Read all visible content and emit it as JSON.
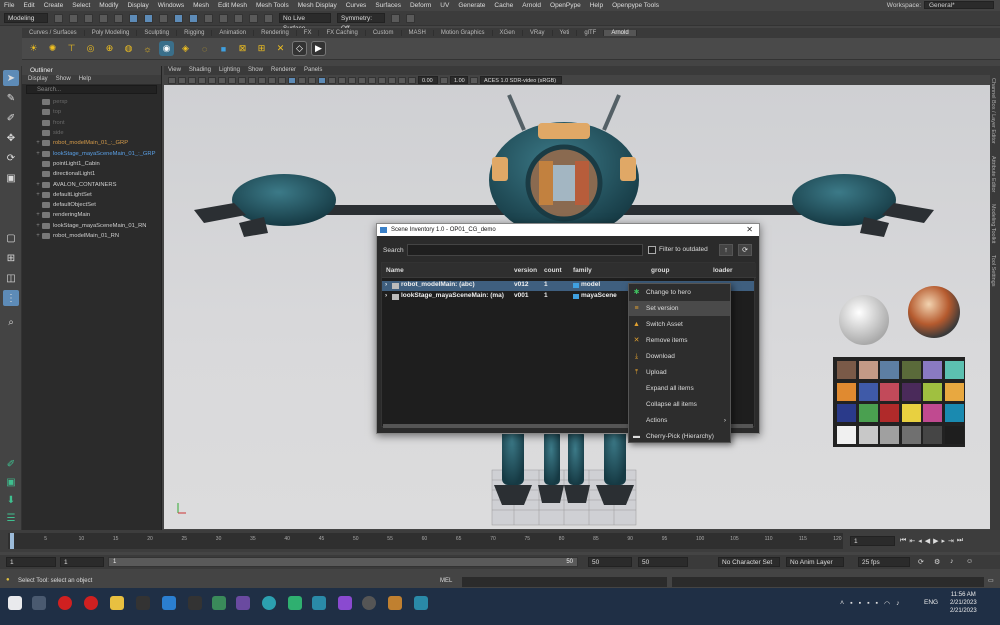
{
  "menubar": {
    "items": [
      "File",
      "Edit",
      "Create",
      "Select",
      "Modify",
      "Display",
      "Windows",
      "Mesh",
      "Edit Mesh",
      "Mesh Tools",
      "Mesh Display",
      "Curves",
      "Surfaces",
      "Deform",
      "UV",
      "Generate",
      "Cache",
      "Arnold",
      "OpenPype",
      "Help",
      "Openpype Tools"
    ],
    "workspace_label": "Workspace:",
    "workspace_value": "General*"
  },
  "statusline": {
    "mode": "Modeling",
    "live_surface": "No Live Surface",
    "symmetry": "Symmetry: Off"
  },
  "shelf_tabs": [
    "Curves / Surfaces",
    "Poly Modeling",
    "Sculpting",
    "Rigging",
    "Animation",
    "Rendering",
    "FX",
    "FX Caching",
    "Custom",
    "MASH",
    "Motion Graphics",
    "XGen",
    "VRay",
    "Yeti",
    "glTF",
    "Arnold"
  ],
  "outliner": {
    "title": "Outliner",
    "menu": [
      "Display",
      "Show",
      "Help"
    ],
    "search_placeholder": "Search...",
    "items": [
      {
        "label": "persp",
        "color": "#6a6a6a"
      },
      {
        "label": "top",
        "color": "#6a6a6a"
      },
      {
        "label": "front",
        "color": "#6a6a6a"
      },
      {
        "label": "side",
        "color": "#6a6a6a"
      },
      {
        "label": "robot_modelMain_01_:_GRP",
        "color": "#d59b4a"
      },
      {
        "label": "lookStage_mayaSceneMain_01_:_GRP",
        "color": "#5aa0e6"
      },
      {
        "label": "pointLight1_Cabin",
        "color": "#cfcfcf"
      },
      {
        "label": "directionalLight1",
        "color": "#cfcfcf"
      },
      {
        "label": "AVALON_CONTAINERS",
        "color": "#cfcfcf"
      },
      {
        "label": "defaultLightSet",
        "color": "#cfcfcf"
      },
      {
        "label": "defaultObjectSet",
        "color": "#cfcfcf"
      },
      {
        "label": "renderingMain",
        "color": "#cfcfcf"
      },
      {
        "label": "lookStage_mayaSceneMain_01_RN",
        "color": "#cfcfcf"
      },
      {
        "label": "robot_modelMain_01_RN",
        "color": "#cfcfcf"
      }
    ]
  },
  "panel_menu": [
    "View",
    "Shading",
    "Lighting",
    "Show",
    "Renderer",
    "Panels"
  ],
  "panel_tools": {
    "exposure": "0.00",
    "gamma": "1.00",
    "colorspace": "ACES 1.0 SDR-video (sRGB)"
  },
  "right_strip": [
    "Channel Box / Layer Editor",
    "Attribute Editor",
    "Modeling Toolkit",
    "Tool Settings"
  ],
  "dialog": {
    "title": "Scene Inventory 1.0 - OP01_CG_demo",
    "search_label": "Search",
    "filter_label": "Filter to outdated",
    "columns": [
      "Name",
      "version",
      "count",
      "family",
      "group",
      "loader"
    ],
    "rows": [
      {
        "name": "robot_modelMain: (abc)",
        "version": "v012",
        "count": "1",
        "family": "model"
      },
      {
        "name": "lookStage_mayaSceneMain: (ma)",
        "version": "v001",
        "count": "1",
        "family": "mayaScene"
      }
    ]
  },
  "context_menu": [
    {
      "label": "Change to hero",
      "icon": "✱",
      "color": "#3fbf5f"
    },
    {
      "label": "Set version",
      "icon": "≡",
      "color": "#e0a030"
    },
    {
      "label": "Switch Asset",
      "icon": "▲",
      "color": "#e0a030"
    },
    {
      "label": "Remove items",
      "icon": "✕",
      "color": "#e0a030"
    },
    {
      "label": "Download",
      "icon": "⤓",
      "color": "#e0a030"
    },
    {
      "label": "Upload",
      "icon": "⤒",
      "color": "#e0a030"
    },
    {
      "label": "Expand all items",
      "icon": "",
      "color": "#e0a030"
    },
    {
      "label": "Collapse all items",
      "icon": "",
      "color": "#e0a030"
    },
    {
      "label": "Actions",
      "icon": "",
      "color": "#e0a030"
    },
    {
      "label": "Cherry-Pick (Hierarchy)",
      "icon": "▬",
      "color": "#ddd"
    }
  ],
  "timeslider": {
    "ticks": [
      "1",
      "5",
      "10",
      "15",
      "20",
      "25",
      "30",
      "35",
      "40",
      "45",
      "50",
      "55",
      "60",
      "65",
      "70",
      "75",
      "80",
      "85",
      "90",
      "95",
      "100",
      "105",
      "110",
      "115",
      "120"
    ],
    "current_frame": "1"
  },
  "range": {
    "start": "1",
    "playback_start": "1",
    "range_label": "1",
    "range_end": "50",
    "playback_end": "50",
    "end": "50",
    "character_set": "No Character Set",
    "anim_layer": "No Anim Layer",
    "fps": "25 fps"
  },
  "helpline": {
    "text": "Select Tool: select an object",
    "mel": "MEL"
  },
  "taskbar": {
    "language": "ENG",
    "time": "11:56 AM",
    "date1": "2/21/2023",
    "date2": "2/21/2023"
  },
  "colors": {
    "accent": "#5d8bb7",
    "selection": "#3f5f7f"
  }
}
